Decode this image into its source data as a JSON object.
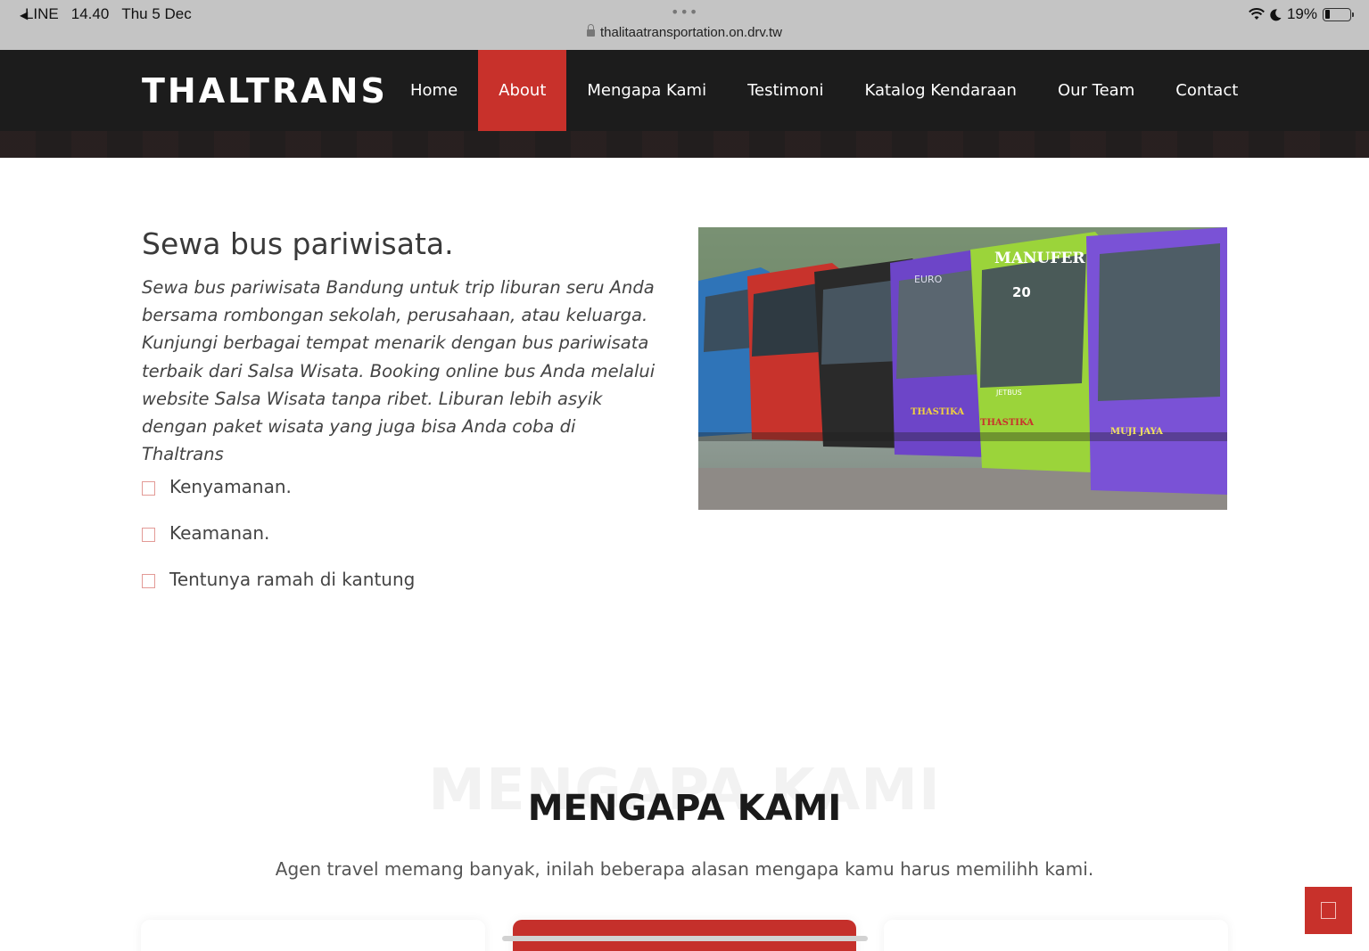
{
  "status_bar": {
    "back_app": "LINE",
    "time": "14.40",
    "date": "Thu 5 Dec",
    "url": "thalitaatransportation.on.drv.tw",
    "battery": "19%",
    "battery_level": 0.19
  },
  "navbar": {
    "logo": "THALTRANS",
    "items": [
      {
        "label": "Home"
      },
      {
        "label": "About",
        "active": true
      },
      {
        "label": "Mengapa Kami"
      },
      {
        "label": "Testimoni"
      },
      {
        "label": "Katalog Kendaraan"
      },
      {
        "label": "Our Team"
      },
      {
        "label": "Contact"
      }
    ]
  },
  "about": {
    "title": "Sewa bus pariwisata.",
    "paragraph": "Sewa bus pariwisata Bandung untuk trip liburan seru Anda bersama rombongan sekolah, perusahaan, atau keluarga. Kunjungi berbagai tempat menarik dengan bus pariwisata terbaik dari Salsa Wisata. Booking online bus Anda melalui website Salsa Wisata tanpa ribet. Liburan lebih asyik dengan paket wisata yang juga bisa Anda coba di Thaltrans",
    "features": [
      "Kenyamanan.",
      "Keamanan.",
      "Tentunya ramah di kantung"
    ],
    "image_labels": [
      "EURO",
      "MANUFER",
      "20",
      "JETBUS",
      "THASTIKA",
      "THASTIKA",
      "MUJI JAYA"
    ]
  },
  "mengapa": {
    "background_title": "MENGAPA KAMI",
    "title": "MENGAPA KAMI",
    "subtitle": "Agen travel memang banyak, inilah beberapa alasan mengapa kamu harus memilihh kami."
  },
  "colors": {
    "accent": "#c8312b",
    "navbar": "#1c1c1c",
    "status_bar": "#c4c4c4"
  },
  "icons": {
    "check": "check-square-icon",
    "back_to_top": "arrow-up-icon",
    "lock": "lock-icon",
    "wifi": "wifi-icon",
    "moon": "moon-icon",
    "battery": "battery-icon"
  }
}
